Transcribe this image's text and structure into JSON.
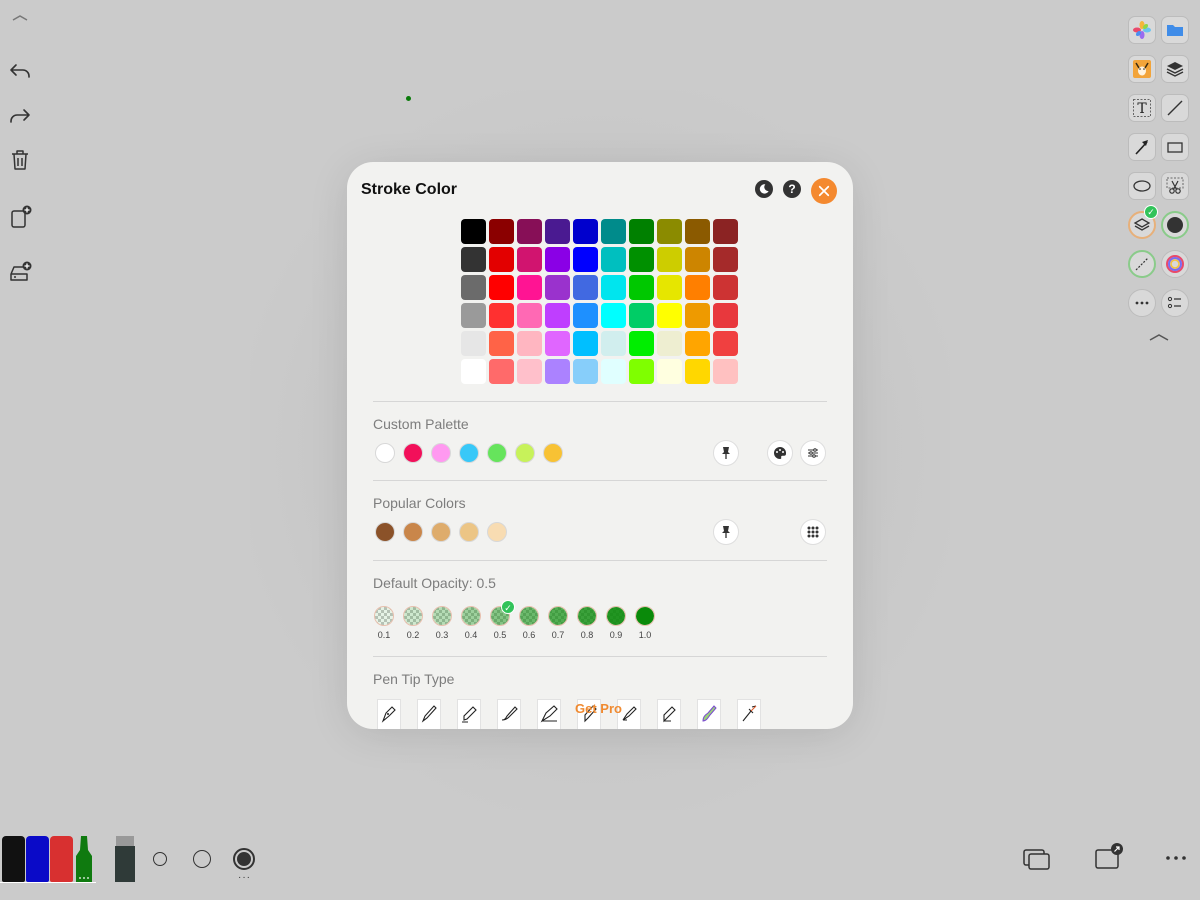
{
  "modal": {
    "title": "Stroke Color",
    "close_icon": "close-icon",
    "theme_icon": "moon-icon",
    "help_label": "?",
    "color_grid": [
      [
        "#000000",
        "#8b0000",
        "#870f57",
        "#4a1a91",
        "#0000cd",
        "#008b8b",
        "#008000",
        "#8b8b00",
        "#8b5a00",
        "#8b2323"
      ],
      [
        "#333333",
        "#e30000",
        "#d1146f",
        "#8a00e6",
        "#0000ff",
        "#00bfbf",
        "#009000",
        "#cdcd00",
        "#cd8500",
        "#a52a2a"
      ],
      [
        "#6b6b6b",
        "#ff0000",
        "#ff1493",
        "#9a32cd",
        "#4169e1",
        "#00e5ee",
        "#00c800",
        "#e6e600",
        "#ff7f00",
        "#cd3333"
      ],
      [
        "#9a9a9a",
        "#ff3030",
        "#ff69b4",
        "#bf3eff",
        "#1e90ff",
        "#00ffff",
        "#00cd66",
        "#ffff00",
        "#ee9a00",
        "#e8383d"
      ],
      [
        "#e6e6e6",
        "#ff6347",
        "#ffb6c1",
        "#e066ff",
        "#00bfff",
        "#d1eeee",
        "#00ee00",
        "#eeeed1",
        "#ffa500",
        "#f04040"
      ],
      [
        "#ffffff",
        "#ff6a6a",
        "#ffc0cb",
        "#ab82ff",
        "#87cefa",
        "#e0ffff",
        "#7fff00",
        "#ffffe0",
        "#ffd700",
        "#ffc1c1"
      ]
    ],
    "custom_palette": {
      "label": "Custom Palette",
      "colors": [
        "#ffffff",
        "#f2105a",
        "#ff99f0",
        "#38c8f8",
        "#66e45c",
        "#c7f25a",
        "#f8c234"
      ],
      "pin_icon": "pin-icon",
      "palette_icon": "palette-icon",
      "adjust_icon": "sliders-icon"
    },
    "popular_colors": {
      "label": "Popular Colors",
      "colors": [
        "#8b5229",
        "#c9864a",
        "#deac6c",
        "#ecc585",
        "#f8dcb2"
      ],
      "pin_icon": "pin-icon",
      "grid_icon": "grid-icon"
    },
    "opacity": {
      "label": "Default Opacity: 0.5",
      "options": [
        {
          "label": "0.1",
          "value": 0.1
        },
        {
          "label": "0.2",
          "value": 0.2
        },
        {
          "label": "0.3",
          "value": 0.3
        },
        {
          "label": "0.4",
          "value": 0.4
        },
        {
          "label": "0.5",
          "value": 0.5
        },
        {
          "label": "0.6",
          "value": 0.6
        },
        {
          "label": "0.7",
          "value": 0.7
        },
        {
          "label": "0.8",
          "value": 0.8
        },
        {
          "label": "0.9",
          "value": 0.9
        },
        {
          "label": "1.0",
          "value": 1.0
        }
      ],
      "selected": "0.5",
      "fill_color": "#0a8a0a"
    },
    "pen_tip": {
      "label": "Pen Tip Type",
      "get_pro": "Get Pro",
      "tips": [
        "fountain-pen-icon",
        "brush-icon",
        "marker-icon",
        "paint-brush-icon",
        "calligraphy-icon",
        "pencil-icon",
        "highlighter-icon",
        "felt-tip-icon",
        "gradient-brush-icon",
        "airbrush-icon"
      ]
    }
  },
  "left_toolbar": [
    "collapse-icon",
    "undo-icon",
    "redo-icon",
    "trash-icon",
    "add-page-icon",
    "add-storage-icon"
  ],
  "right_toolbar": {
    "items": [
      "photos-icon",
      "folder-icon",
      "fox-avatar-icon",
      "layers-icon",
      "text-icon",
      "line-icon",
      "arrow-icon",
      "rectangle-icon",
      "ellipse-icon",
      "scissors-icon",
      "layer-select-icon",
      "fill-color-icon",
      "stroke-style-icon",
      "color-wheel-icon",
      "more-icon",
      "list-icon",
      "collapse-icon"
    ]
  },
  "bottom_bar": {
    "markers": [
      "#111111",
      "#0a0ac8",
      "#d83030",
      "#0f7a0f"
    ],
    "eraser_color": "#2f3a38",
    "sizes": [
      "small",
      "medium",
      "large"
    ]
  },
  "accent": "#f4892f"
}
